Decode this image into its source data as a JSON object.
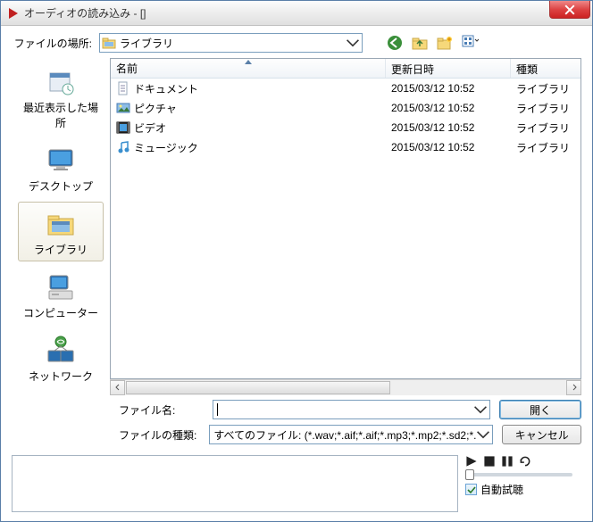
{
  "window": {
    "title": "オーディオの読み込み - []"
  },
  "location": {
    "label": "ファイルの場所:",
    "value": "ライブラリ"
  },
  "sidebar": {
    "items": [
      {
        "label": "最近表示した場所"
      },
      {
        "label": "デスクトップ"
      },
      {
        "label": "ライブラリ"
      },
      {
        "label": "コンピューター"
      },
      {
        "label": "ネットワーク"
      }
    ]
  },
  "columns": {
    "name": "名前",
    "date": "更新日時",
    "type": "種類"
  },
  "files": [
    {
      "name": "ドキュメント",
      "date": "2015/03/12 10:52",
      "type": "ライブラリ",
      "icon": "document"
    },
    {
      "name": "ピクチャ",
      "date": "2015/03/12 10:52",
      "type": "ライブラリ",
      "icon": "picture"
    },
    {
      "name": "ビデオ",
      "date": "2015/03/12 10:52",
      "type": "ライブラリ",
      "icon": "video"
    },
    {
      "name": "ミュージック",
      "date": "2015/03/12 10:52",
      "type": "ライブラリ",
      "icon": "music"
    }
  ],
  "form": {
    "filename_label": "ファイル名:",
    "filename_value": "",
    "filetype_label": "ファイルの種類:",
    "filetype_value": "すべてのファイル: (*.wav;*.aif;*.aif;*.mp3;*.mp2;*.sd2;*.",
    "open_button": "開く",
    "cancel_button": "キャンセル"
  },
  "player": {
    "auto_preview_label": "自動試聴"
  }
}
